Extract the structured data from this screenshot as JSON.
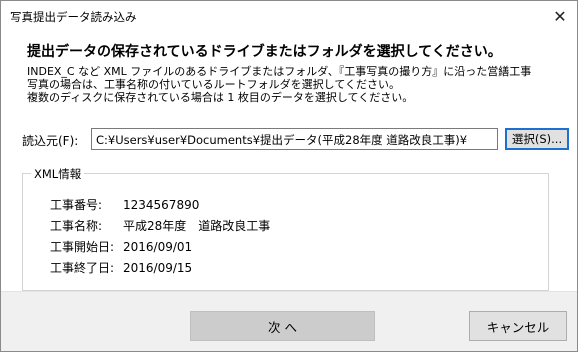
{
  "window": {
    "title": "写真提出データ読み込み",
    "close_glyph": "✕"
  },
  "main": {
    "heading": "提出データの保存されているドライブまたはフォルダを選択してください。",
    "description": [
      "INDEX_C など XML ファイルのあるドライブまたはフォルダ、『工事写真の撮り方』に沿った営繕工事",
      "写真の場合は、工事名称の付いているルートフォルダを選択してください。",
      "複数のディスクに保存されている場合は 1 枚目のデータを選択してください。"
    ],
    "source": {
      "label": "読込元(F):",
      "value": "C:¥Users¥user¥Documents¥提出データ(平成28年度 道路改良工事)¥",
      "select_button": "選択(S)..."
    },
    "xml_info": {
      "legend": "XML情報",
      "rows": [
        {
          "label": "工事番号:",
          "value": "1234567890"
        },
        {
          "label": "工事名称:",
          "value": "平成28年度　道路改良工事"
        },
        {
          "label": "工事開始日:",
          "value": "2016/09/01"
        },
        {
          "label": "工事終了日:",
          "value": "2016/09/15"
        }
      ]
    }
  },
  "footer": {
    "next_button": "次 へ",
    "cancel_button": "キャンセル"
  }
}
